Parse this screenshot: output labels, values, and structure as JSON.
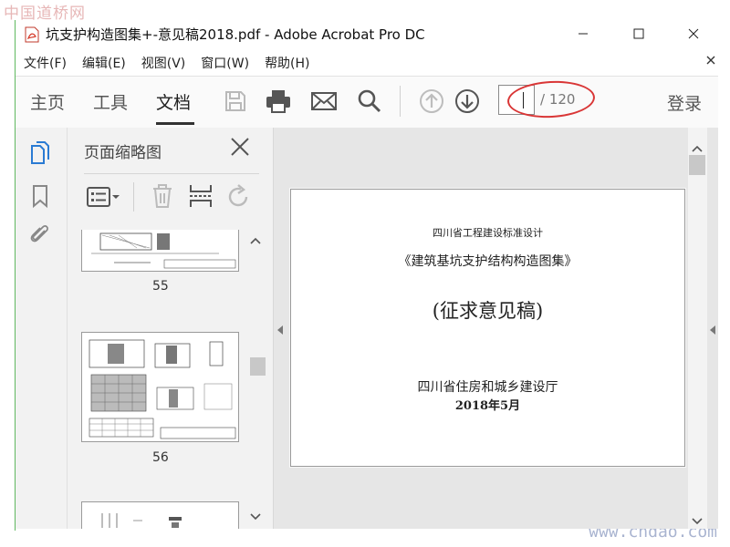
{
  "watermark": {
    "top": "中国道桥网",
    "bottom": "www.cndao.com"
  },
  "window": {
    "title": "坑支护构造图集+-意见稿2018.pdf - Adobe Acrobat Pro DC"
  },
  "menu": {
    "items": [
      "文件(F)",
      "编辑(E)",
      "视图(V)",
      "窗口(W)",
      "帮助(H)"
    ]
  },
  "toolbar": {
    "tabs": [
      "主页",
      "工具",
      "文档"
    ],
    "active_tab": "文档",
    "page_current": "",
    "page_total": "/ 120",
    "login": "登录"
  },
  "thumbnails": {
    "title": "页面缩略图",
    "pages": [
      {
        "label": "55"
      },
      {
        "label": "56"
      }
    ]
  },
  "document": {
    "line1": "四川省工程建设标准设计",
    "line2": "《建筑基坑支护结构构造图集》",
    "line3": "(征求意见稿)",
    "line4": "四川省住房和城乡建设厅",
    "line5": "2018年5月"
  },
  "colors": {
    "annotation": "#d93636",
    "accent_green": "#5fb85f"
  }
}
